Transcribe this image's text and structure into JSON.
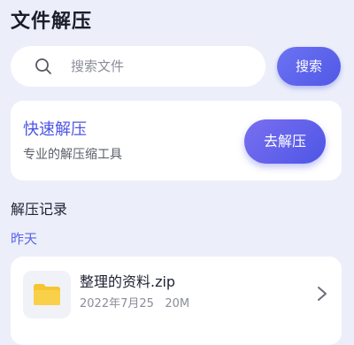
{
  "header": {
    "title": "文件解压"
  },
  "search": {
    "placeholder": "搜索文件",
    "button_label": "搜索",
    "icon": "search-icon"
  },
  "quick_extract": {
    "title": "快速解压",
    "subtitle": "专业的解压缩工具",
    "button_label": "去解压"
  },
  "history": {
    "heading": "解压记录",
    "groups": [
      {
        "date_label": "昨天",
        "items": [
          {
            "name": "整理的资料.zip",
            "date": "2022年7月25",
            "size": "20M",
            "icon": "folder-icon"
          }
        ]
      }
    ]
  },
  "colors": {
    "accent": "#4c55e4",
    "background": "#eceffa",
    "folder": "#f7c531"
  }
}
